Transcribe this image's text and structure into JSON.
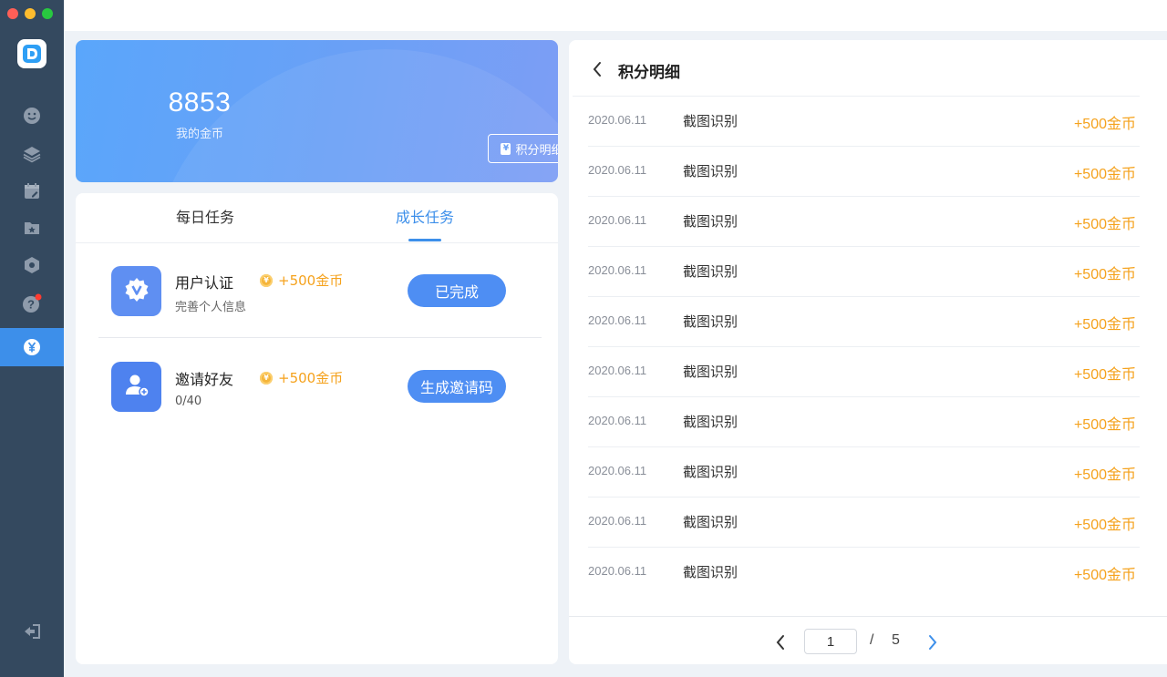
{
  "colors": {
    "sidebar_bg": "#34495f",
    "accent_blue": "#3d8fea",
    "reward_orange": "#f5a21d"
  },
  "sidebar": {
    "items": [
      {
        "icon": "smile-face-icon",
        "active": false
      },
      {
        "icon": "layers-icon",
        "active": false
      },
      {
        "icon": "calendar-edit-icon",
        "active": false
      },
      {
        "icon": "star-folder-icon",
        "active": false
      },
      {
        "icon": "hexagon-settings-icon",
        "active": false
      },
      {
        "icon": "help-icon",
        "active": false,
        "badge": true
      },
      {
        "icon": "yen-coin-icon",
        "active": true
      }
    ],
    "logout_icon": "logout-icon"
  },
  "coin_card": {
    "amount": "8853",
    "label": "我的金币",
    "detail_button": "积分明细",
    "detail_icon_glyph": "¥"
  },
  "tasks": {
    "tabs": [
      {
        "label": "每日任务",
        "active": false
      },
      {
        "label": "成长任务",
        "active": true
      }
    ],
    "items": [
      {
        "title": "用户认证",
        "reward": "+500金币",
        "subtitle": "完善个人信息",
        "button": "已完成",
        "icon": "verified-badge-icon"
      },
      {
        "title": "邀请好友",
        "reward": "+500金币",
        "subtitle": "0/40",
        "button": "生成邀请码",
        "icon": "add-user-icon"
      }
    ],
    "coin_glyph": "¥"
  },
  "points_detail": {
    "title": "积分明细",
    "records": [
      {
        "date": "2020.06.11",
        "desc": "截图识别",
        "amount": "+500金币"
      },
      {
        "date": "2020.06.11",
        "desc": "截图识别",
        "amount": "+500金币"
      },
      {
        "date": "2020.06.11",
        "desc": "截图识别",
        "amount": "+500金币"
      },
      {
        "date": "2020.06.11",
        "desc": "截图识别",
        "amount": "+500金币"
      },
      {
        "date": "2020.06.11",
        "desc": "截图识别",
        "amount": "+500金币"
      },
      {
        "date": "2020.06.11",
        "desc": "截图识别",
        "amount": "+500金币"
      },
      {
        "date": "2020.06.11",
        "desc": "截图识别",
        "amount": "+500金币"
      },
      {
        "date": "2020.06.11",
        "desc": "截图识别",
        "amount": "+500金币"
      },
      {
        "date": "2020.06.11",
        "desc": "截图识别",
        "amount": "+500金币"
      },
      {
        "date": "2020.06.11",
        "desc": "截图识别",
        "amount": "+500金币"
      }
    ],
    "pagination": {
      "current_page": "1",
      "separator": "/",
      "total_pages": "5"
    }
  }
}
